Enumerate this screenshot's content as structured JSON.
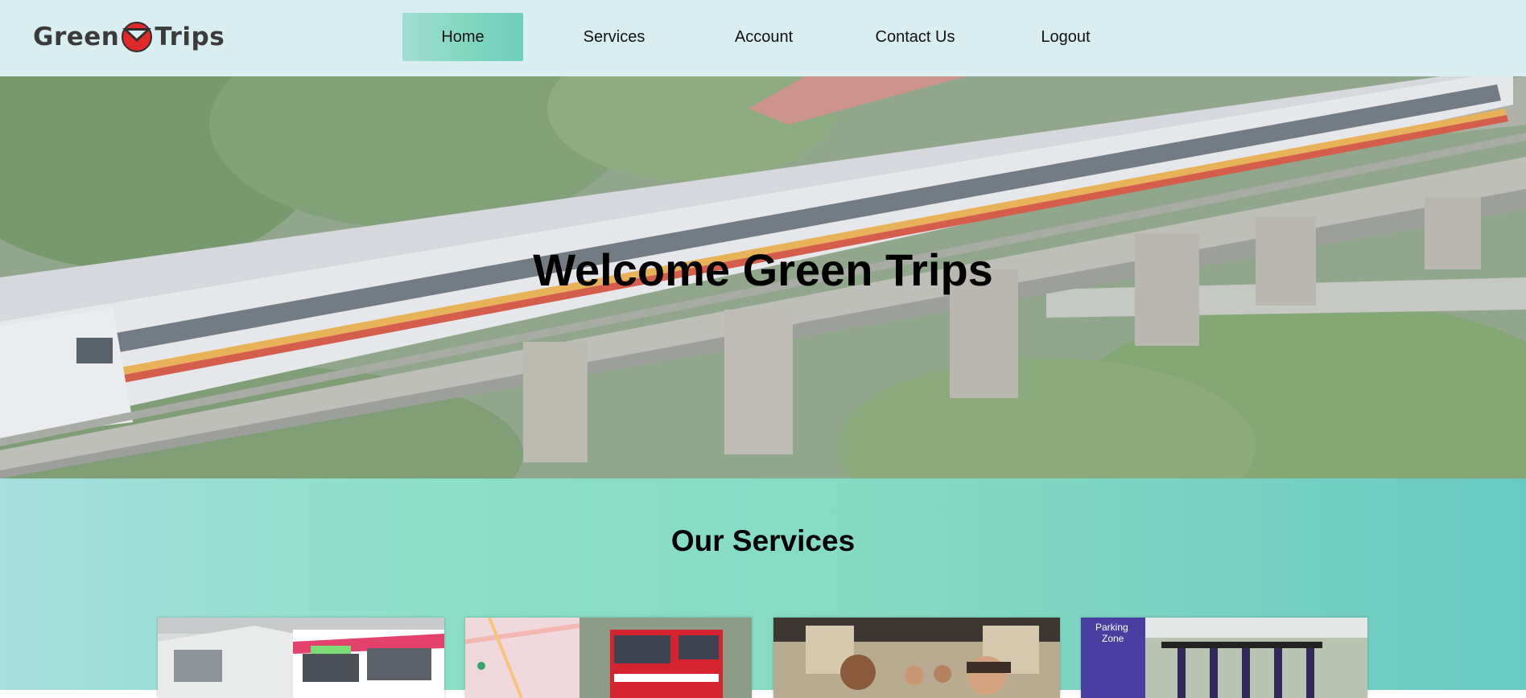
{
  "brand": {
    "left": "Green",
    "right": "Trips",
    "accent": "#e02a2a"
  },
  "nav": {
    "items": [
      {
        "label": "Home",
        "active": true
      },
      {
        "label": "Services",
        "active": false
      },
      {
        "label": "Account",
        "active": false
      },
      {
        "label": "Contact Us",
        "active": false
      },
      {
        "label": "Logout",
        "active": false
      }
    ]
  },
  "hero": {
    "title": "Welcome Green Trips"
  },
  "services": {
    "title": "Our Services",
    "cards": [
      {
        "icon": "train-bus-photo"
      },
      {
        "icon": "map-bus-photo"
      },
      {
        "icon": "carpool-photo"
      },
      {
        "icon": "scooter-parking-photo",
        "sign_line1": "Parking",
        "sign_line2": "Zone"
      }
    ]
  },
  "colors": {
    "nav_bg": "#d8eef0",
    "active_tab": "#7fd8be",
    "services_bg": "#84dac2"
  }
}
